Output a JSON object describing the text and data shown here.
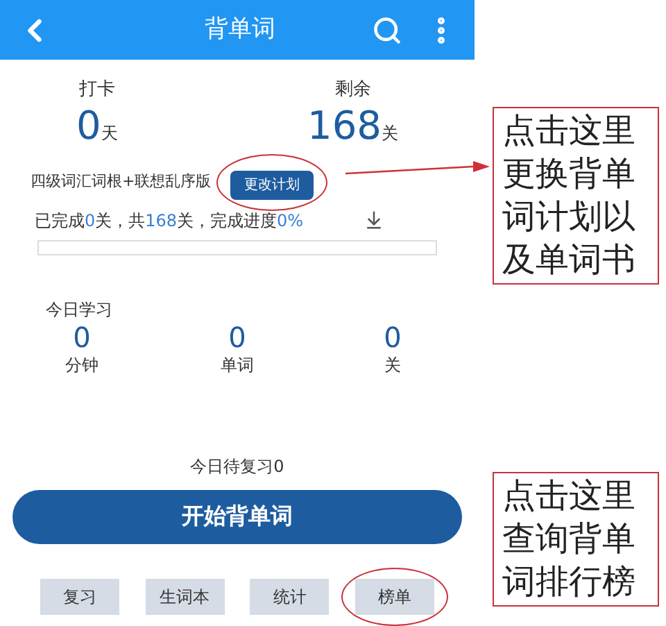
{
  "header": {
    "title": "背单词"
  },
  "stats": [
    {
      "label": "打卡",
      "value": "0",
      "unit": "天"
    },
    {
      "label": "剩余",
      "value": "168",
      "unit": "关"
    }
  ],
  "plan": {
    "name": "四级词汇词根+联想乱序版",
    "button": "更改计划",
    "circled": true
  },
  "progress_parts": [
    {
      "text": "已完成",
      "highlight": false
    },
    {
      "text": "0",
      "highlight": true
    },
    {
      "text": "关，共",
      "highlight": false
    },
    {
      "text": "168",
      "highlight": true
    },
    {
      "text": "关，完成进度",
      "highlight": false
    },
    {
      "text": "0%",
      "highlight": true
    }
  ],
  "progress": {
    "level": 0
  },
  "today": {
    "title": "今日学习",
    "items": [
      {
        "value": "0",
        "unit": "分钟"
      },
      {
        "value": "0",
        "unit": "单词"
      },
      {
        "value": "0",
        "unit": "关"
      }
    ]
  },
  "review_text": "今日待复习0",
  "start_button": "开始背单词",
  "bottom_buttons": [
    {
      "label": "复习",
      "circled": false
    },
    {
      "label": "生词本",
      "circled": false
    },
    {
      "label": "统计",
      "circled": false
    },
    {
      "label": "榜单",
      "circled": true
    }
  ],
  "callouts": [
    "点击这里更换背单词计划以及单词书",
    "点击这里查询背单词排行榜"
  ]
}
